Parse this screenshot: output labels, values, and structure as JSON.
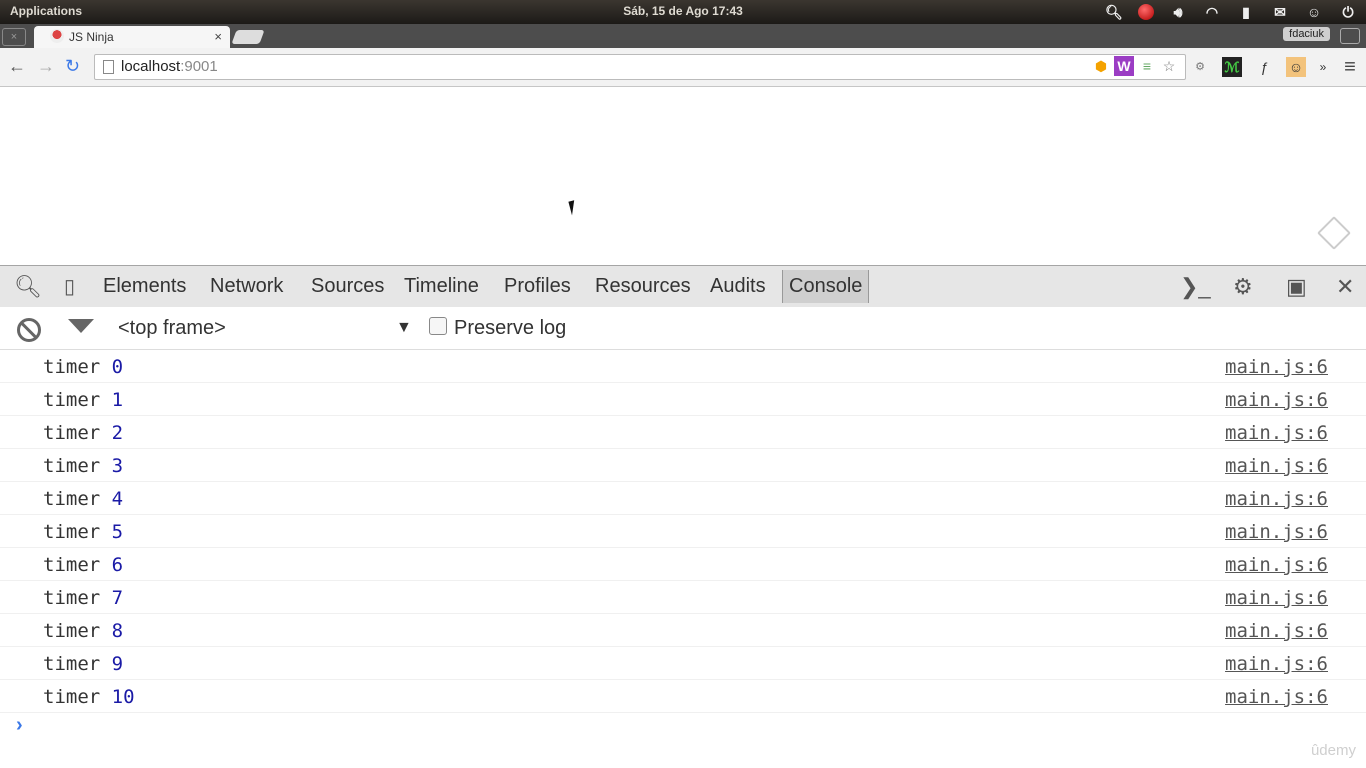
{
  "os_panel": {
    "apps_label": "Applications",
    "clock": "Sáb, 15 de Ago 17:43"
  },
  "tabs": {
    "active_title": "JS Ninja",
    "close_glyph": "×",
    "profile_name": "fdaciuk"
  },
  "toolbar": {
    "url_host": "localhost",
    "url_port": ":9001"
  },
  "devtools": {
    "tabs": [
      "Elements",
      "Network",
      "Sources",
      "Timeline",
      "Profiles",
      "Resources",
      "Audits",
      "Console"
    ],
    "active_tab": "Console",
    "frame_select": "<top frame>",
    "preserve_log_label": "Preserve log",
    "preserve_log_checked": false
  },
  "console": {
    "rows": [
      {
        "text": "timer",
        "value": "0",
        "source": "main.js:6"
      },
      {
        "text": "timer",
        "value": "1",
        "source": "main.js:6"
      },
      {
        "text": "timer",
        "value": "2",
        "source": "main.js:6"
      },
      {
        "text": "timer",
        "value": "3",
        "source": "main.js:6"
      },
      {
        "text": "timer",
        "value": "4",
        "source": "main.js:6"
      },
      {
        "text": "timer",
        "value": "5",
        "source": "main.js:6"
      },
      {
        "text": "timer",
        "value": "6",
        "source": "main.js:6"
      },
      {
        "text": "timer",
        "value": "7",
        "source": "main.js:6"
      },
      {
        "text": "timer",
        "value": "8",
        "source": "main.js:6"
      },
      {
        "text": "timer",
        "value": "9",
        "source": "main.js:6"
      },
      {
        "text": "timer",
        "value": "10",
        "source": "main.js:6"
      }
    ],
    "prompt_glyph": "›"
  },
  "watermark": "ûdemy",
  "colors": {
    "link_number": "#1a1aa6",
    "prompt": "#3b78e7"
  }
}
